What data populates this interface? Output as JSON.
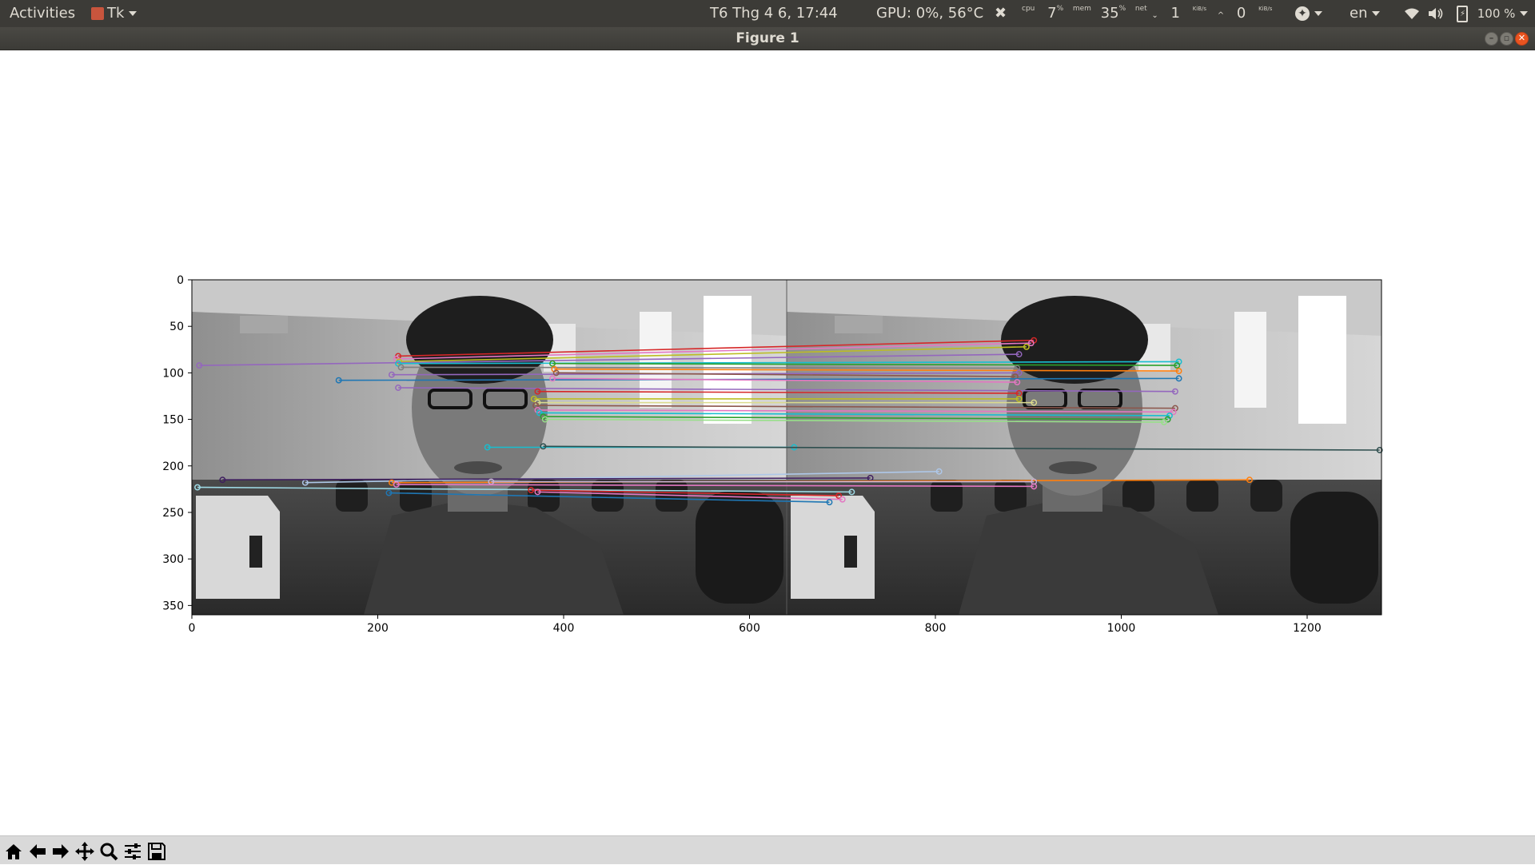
{
  "topbar": {
    "activities": "Activities",
    "app_menu": "Tk",
    "clock": "T6 Thg 4  6, 17:44",
    "gpu": "GPU: 0%, 56°C",
    "cpu_label": "cpu",
    "cpu_value": "7",
    "cpu_unit": "%",
    "mem_label": "mem",
    "mem_value": "35",
    "mem_unit": "%",
    "net_label": "net",
    "net_down": "1",
    "net_down_unit": "KiB/s",
    "net_up": "0",
    "net_up_unit": "KiB/s",
    "language": "en",
    "battery": "100 %"
  },
  "window": {
    "title": "Figure 1"
  },
  "colors": {
    "topbar_bg": "#3c3b37",
    "close_button": "#e95420",
    "toolbar_bg": "#d9d9d9"
  },
  "chart_data": {
    "type": "image",
    "title": "",
    "xlabel": "",
    "ylabel": "",
    "xlim": [
      0,
      1280
    ],
    "ylim": [
      360,
      0
    ],
    "xticks": [
      0,
      200,
      400,
      600,
      800,
      1000,
      1200
    ],
    "yticks": [
      0,
      50,
      100,
      150,
      200,
      250,
      300,
      350
    ],
    "image_split_x": 640,
    "matches": [
      {
        "x1": 222,
        "y1": 82,
        "x2": 906,
        "y2": 65,
        "color": "#d62728"
      },
      {
        "x1": 220,
        "y1": 85,
        "x2": 903,
        "y2": 68,
        "color": "#e377c2"
      },
      {
        "x1": 223,
        "y1": 88,
        "x2": 898,
        "y2": 72,
        "color": "#bcbd22"
      },
      {
        "x1": 8,
        "y1": 92,
        "x2": 890,
        "y2": 80,
        "color": "#9467bd"
      },
      {
        "x1": 222,
        "y1": 90,
        "x2": 1062,
        "y2": 88,
        "color": "#17becf"
      },
      {
        "x1": 388,
        "y1": 90,
        "x2": 1060,
        "y2": 92,
        "color": "#2ca02c"
      },
      {
        "x1": 225,
        "y1": 94,
        "x2": 888,
        "y2": 95,
        "color": "#7f7f7f"
      },
      {
        "x1": 390,
        "y1": 96,
        "x2": 1062,
        "y2": 98,
        "color": "#ff7f0e"
      },
      {
        "x1": 215,
        "y1": 102,
        "x2": 890,
        "y2": 100,
        "color": "#9467bd"
      },
      {
        "x1": 392,
        "y1": 100,
        "x2": 886,
        "y2": 104,
        "color": "#8c564b"
      },
      {
        "x1": 158,
        "y1": 108,
        "x2": 1062,
        "y2": 106,
        "color": "#1f77b4"
      },
      {
        "x1": 388,
        "y1": 106,
        "x2": 888,
        "y2": 110,
        "color": "#e377c2"
      },
      {
        "x1": 222,
        "y1": 116,
        "x2": 1058,
        "y2": 120,
        "color": "#9467bd"
      },
      {
        "x1": 372,
        "y1": 120,
        "x2": 890,
        "y2": 122,
        "color": "#d62728"
      },
      {
        "x1": 368,
        "y1": 128,
        "x2": 890,
        "y2": 128,
        "color": "#bcbd22"
      },
      {
        "x1": 372,
        "y1": 132,
        "x2": 906,
        "y2": 132,
        "color": "#dbdb8d"
      },
      {
        "x1": 370,
        "y1": 135,
        "x2": 1058,
        "y2": 138,
        "color": "#8c564b"
      },
      {
        "x1": 372,
        "y1": 140,
        "x2": 1056,
        "y2": 142,
        "color": "#e377c2"
      },
      {
        "x1": 374,
        "y1": 143,
        "x2": 1052,
        "y2": 146,
        "color": "#17becf"
      },
      {
        "x1": 378,
        "y1": 147,
        "x2": 1050,
        "y2": 150,
        "color": "#2ca02c"
      },
      {
        "x1": 380,
        "y1": 150,
        "x2": 1046,
        "y2": 153,
        "color": "#98df8a"
      },
      {
        "x1": 318,
        "y1": 180,
        "x2": 648,
        "y2": 180,
        "color": "#17becf"
      },
      {
        "x1": 378,
        "y1": 179,
        "x2": 1278,
        "y2": 183,
        "color": "#2f4f4f"
      },
      {
        "x1": 122,
        "y1": 218,
        "x2": 804,
        "y2": 206,
        "color": "#aec7e8"
      },
      {
        "x1": 33,
        "y1": 215,
        "x2": 730,
        "y2": 213,
        "color": "#3f1f5f"
      },
      {
        "x1": 215,
        "y1": 218,
        "x2": 1138,
        "y2": 215,
        "color": "#ff7f0e"
      },
      {
        "x1": 322,
        "y1": 217,
        "x2": 906,
        "y2": 217,
        "color": "#c5b0d5"
      },
      {
        "x1": 220,
        "y1": 220,
        "x2": 906,
        "y2": 222,
        "color": "#e377c2"
      },
      {
        "x1": 6,
        "y1": 223,
        "x2": 710,
        "y2": 228,
        "color": "#9edae5"
      },
      {
        "x1": 365,
        "y1": 226,
        "x2": 696,
        "y2": 232,
        "color": "#d62728"
      },
      {
        "x1": 372,
        "y1": 228,
        "x2": 700,
        "y2": 236,
        "color": "#e377c2"
      },
      {
        "x1": 212,
        "y1": 229,
        "x2": 686,
        "y2": 239,
        "color": "#1f77b4"
      }
    ]
  }
}
